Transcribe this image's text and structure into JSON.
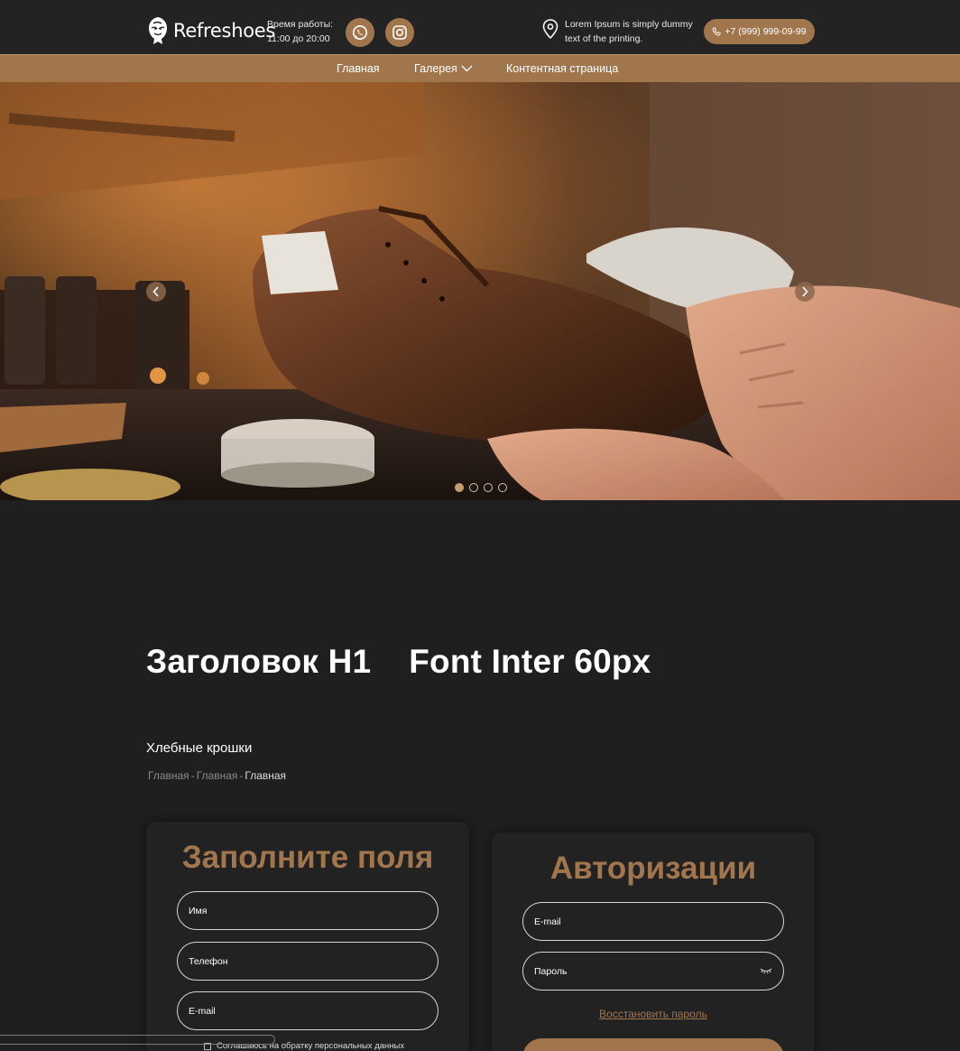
{
  "header": {
    "logo_text": "Refreshoes",
    "hours_label": "Время работы:",
    "hours_value": "11:00 до 20:00",
    "address_line1": "Lorem Ipsum is simply dummy",
    "address_line2": "text of the printing.",
    "phone": "+7 (999) 999-09-99",
    "social": [
      "whatsapp-icon",
      "instagram-icon"
    ]
  },
  "nav": {
    "items": [
      {
        "label": "Главная"
      },
      {
        "label": "Галерея",
        "has_dropdown": true
      },
      {
        "label": "Контентная страница"
      }
    ]
  },
  "slider": {
    "slides_count": 4,
    "active_slide": 1
  },
  "page": {
    "h1": "Заголовок H1    Font Inter 60px",
    "breadcrumbs_title": "Хлебные крошки",
    "breadcrumbs": [
      "Главная",
      "Главная",
      "Главная"
    ],
    "breadcrumb_separator": "-"
  },
  "form_left": {
    "title": "Заполните поля",
    "fields": [
      {
        "placeholder": "Имя"
      },
      {
        "placeholder": "Телефон"
      },
      {
        "placeholder": "E-mail"
      }
    ],
    "consent": "Соглашаюсь на обратку персональных данных"
  },
  "form_right": {
    "title": "Авторизации",
    "fields": [
      {
        "placeholder": "E-mail"
      },
      {
        "placeholder": "Пароль"
      }
    ],
    "restore_link": "Восстановить пароль"
  },
  "colors": {
    "accent": "#a2764d",
    "background": "#1f1f1f",
    "topbar": "#232323"
  }
}
